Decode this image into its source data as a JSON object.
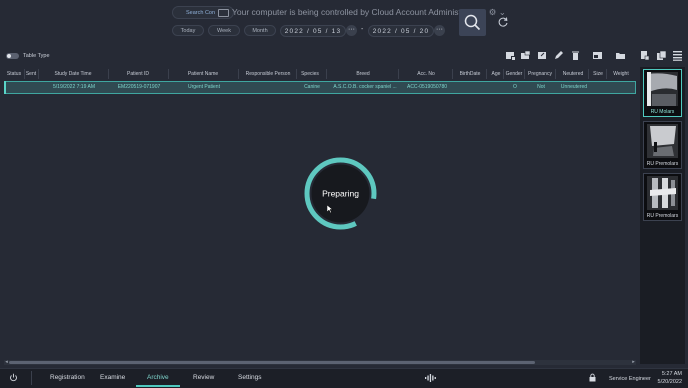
{
  "search": {
    "condition_label": "Search Con"
  },
  "remote_banner": "Your computer is being controlled by Cloud Account Administrator",
  "quick_dates": [
    "Today",
    "Week",
    "Month"
  ],
  "date_range": {
    "from": "2022 / 05 / 13",
    "separator": "-",
    "to": "2022 / 05 / 20",
    "more": "···"
  },
  "toggle": {
    "label": "Table Type"
  },
  "table": {
    "columns": [
      "Status",
      "Sent",
      "Study Date Time",
      "Patient ID",
      "Patient Name",
      "Responsible Person",
      "Species",
      "Breed",
      "Acc. No",
      "BirthDate",
      "Age",
      "Gender",
      "Pregnancy",
      "Neutered",
      "Size",
      "Weight"
    ],
    "row": {
      "status": "",
      "sent": "",
      "study_date_time": "5/19/2022 7:19 AM",
      "patient_id": "EM220519-071907",
      "patient_name": "Urgent Patient",
      "responsible_person": "",
      "species": "Canine",
      "breed": "A.S.C.O.B. cocker spaniel ...",
      "acc_no": "ACC-0519050780",
      "birthdate": "",
      "age": "",
      "gender": "O",
      "pregnancy": "Not",
      "neutered": "Unneutered",
      "size": "",
      "weight": ""
    }
  },
  "overlay": {
    "status": "Preparing",
    "progress": 0.85
  },
  "thumbnails": [
    {
      "label": "RU Molars",
      "selected": true
    },
    {
      "label": "RU Premolars",
      "selected": false
    },
    {
      "label": "RU Premolars",
      "selected": false
    }
  ],
  "bottom_nav": {
    "items": [
      "Registration",
      "Examine",
      "Archive",
      "Review",
      "Settings"
    ],
    "active": "Archive"
  },
  "user": "Service Engineer",
  "clock": {
    "time": "5:27 AM",
    "date": "5/20/2022"
  },
  "colors": {
    "accent": "#4fc9bf",
    "background": "#262a35",
    "selected_row": "#304a52"
  }
}
